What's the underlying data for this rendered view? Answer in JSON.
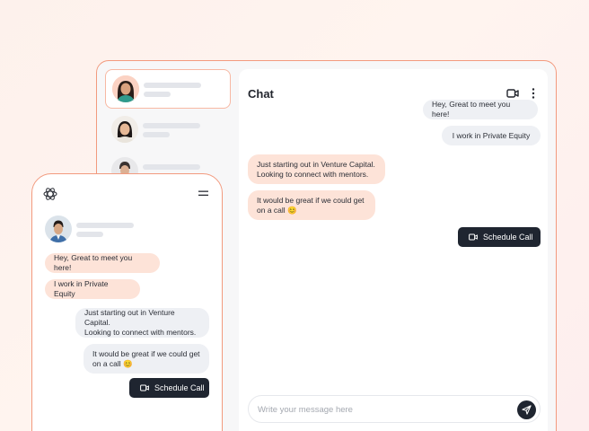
{
  "desktop": {
    "chat_title": "Chat",
    "messages": {
      "m1": "Hey, Great to meet you here!",
      "m2": "I work in Private Equity",
      "m3": "Just starting out in Venture Capital.\nLooking to connect with mentors.",
      "m4": "It would be great if we could get\non a call 😊"
    },
    "schedule_label": "Schedule Call",
    "input_placeholder": "Write your message here"
  },
  "mobile": {
    "messages": {
      "m1": "Hey, Great to meet you here!",
      "m2": "I work in Private Equity",
      "m3": "Just starting out in Venture Capital.\nLooking to connect with mentors.",
      "m4": "It would be great if we could get\non a call 😊"
    },
    "schedule_label": "Schedule Call"
  },
  "colors": {
    "accent": "#f29a7e",
    "bubble_peach": "#fde3d8",
    "bubble_gray": "#eef0f4",
    "button_dark": "#1f2530"
  },
  "icons": [
    "video-icon",
    "more-vertical-icon",
    "send-icon",
    "logo-icon",
    "menu-icon"
  ]
}
